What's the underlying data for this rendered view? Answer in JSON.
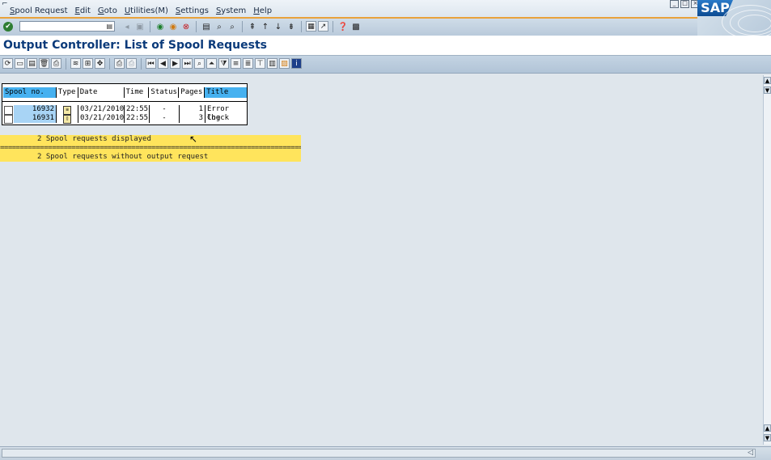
{
  "menubar": {
    "items": [
      "Spool Request",
      "Edit",
      "Goto",
      "Utilities(M)",
      "Settings",
      "System",
      "Help"
    ]
  },
  "logo": {
    "text": "SAP"
  },
  "title": "Output Controller: List of Spool Requests",
  "table": {
    "headers": [
      "Spool no.",
      "Type",
      "Date",
      "Time",
      "Status",
      "Pages",
      "Title"
    ],
    "rows": [
      {
        "spool_no": "16932",
        "date": "03/21/2010",
        "time": "22:55",
        "status": "-",
        "pages": "1",
        "title": "Error log"
      },
      {
        "spool_no": "16931",
        "date": "03/21/2010",
        "time": "22:55",
        "status": "-",
        "pages": "3",
        "title": "Check"
      }
    ]
  },
  "messages": {
    "line1": "2 Spool requests displayed",
    "separator": "==================================================================================================",
    "line2": "2 Spool requests without output request"
  },
  "colors": {
    "accent": "#e9a23b",
    "header_cell": "#46b1f0",
    "message_bg": "#ffe45c",
    "title_text": "#0a3a7a"
  }
}
